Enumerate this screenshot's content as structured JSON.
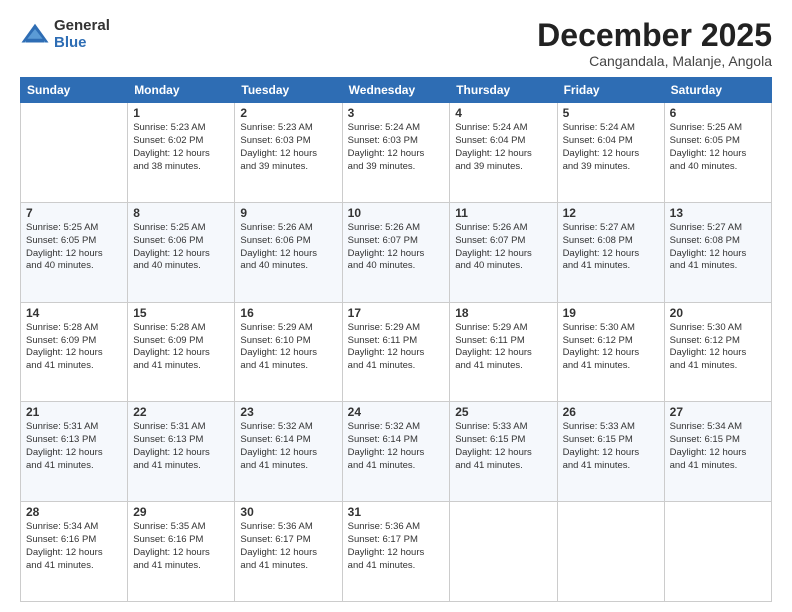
{
  "logo": {
    "general": "General",
    "blue": "Blue"
  },
  "title": {
    "month": "December 2025",
    "location": "Cangandala, Malanje, Angola"
  },
  "headers": [
    "Sunday",
    "Monday",
    "Tuesday",
    "Wednesday",
    "Thursday",
    "Friday",
    "Saturday"
  ],
  "weeks": [
    [
      {
        "day": "",
        "info": ""
      },
      {
        "day": "1",
        "info": "Sunrise: 5:23 AM\nSunset: 6:02 PM\nDaylight: 12 hours\nand 38 minutes."
      },
      {
        "day": "2",
        "info": "Sunrise: 5:23 AM\nSunset: 6:03 PM\nDaylight: 12 hours\nand 39 minutes."
      },
      {
        "day": "3",
        "info": "Sunrise: 5:24 AM\nSunset: 6:03 PM\nDaylight: 12 hours\nand 39 minutes."
      },
      {
        "day": "4",
        "info": "Sunrise: 5:24 AM\nSunset: 6:04 PM\nDaylight: 12 hours\nand 39 minutes."
      },
      {
        "day": "5",
        "info": "Sunrise: 5:24 AM\nSunset: 6:04 PM\nDaylight: 12 hours\nand 39 minutes."
      },
      {
        "day": "6",
        "info": "Sunrise: 5:25 AM\nSunset: 6:05 PM\nDaylight: 12 hours\nand 40 minutes."
      }
    ],
    [
      {
        "day": "7",
        "info": "Sunrise: 5:25 AM\nSunset: 6:05 PM\nDaylight: 12 hours\nand 40 minutes."
      },
      {
        "day": "8",
        "info": "Sunrise: 5:25 AM\nSunset: 6:06 PM\nDaylight: 12 hours\nand 40 minutes."
      },
      {
        "day": "9",
        "info": "Sunrise: 5:26 AM\nSunset: 6:06 PM\nDaylight: 12 hours\nand 40 minutes."
      },
      {
        "day": "10",
        "info": "Sunrise: 5:26 AM\nSunset: 6:07 PM\nDaylight: 12 hours\nand 40 minutes."
      },
      {
        "day": "11",
        "info": "Sunrise: 5:26 AM\nSunset: 6:07 PM\nDaylight: 12 hours\nand 40 minutes."
      },
      {
        "day": "12",
        "info": "Sunrise: 5:27 AM\nSunset: 6:08 PM\nDaylight: 12 hours\nand 41 minutes."
      },
      {
        "day": "13",
        "info": "Sunrise: 5:27 AM\nSunset: 6:08 PM\nDaylight: 12 hours\nand 41 minutes."
      }
    ],
    [
      {
        "day": "14",
        "info": "Sunrise: 5:28 AM\nSunset: 6:09 PM\nDaylight: 12 hours\nand 41 minutes."
      },
      {
        "day": "15",
        "info": "Sunrise: 5:28 AM\nSunset: 6:09 PM\nDaylight: 12 hours\nand 41 minutes."
      },
      {
        "day": "16",
        "info": "Sunrise: 5:29 AM\nSunset: 6:10 PM\nDaylight: 12 hours\nand 41 minutes."
      },
      {
        "day": "17",
        "info": "Sunrise: 5:29 AM\nSunset: 6:11 PM\nDaylight: 12 hours\nand 41 minutes."
      },
      {
        "day": "18",
        "info": "Sunrise: 5:29 AM\nSunset: 6:11 PM\nDaylight: 12 hours\nand 41 minutes."
      },
      {
        "day": "19",
        "info": "Sunrise: 5:30 AM\nSunset: 6:12 PM\nDaylight: 12 hours\nand 41 minutes."
      },
      {
        "day": "20",
        "info": "Sunrise: 5:30 AM\nSunset: 6:12 PM\nDaylight: 12 hours\nand 41 minutes."
      }
    ],
    [
      {
        "day": "21",
        "info": "Sunrise: 5:31 AM\nSunset: 6:13 PM\nDaylight: 12 hours\nand 41 minutes."
      },
      {
        "day": "22",
        "info": "Sunrise: 5:31 AM\nSunset: 6:13 PM\nDaylight: 12 hours\nand 41 minutes."
      },
      {
        "day": "23",
        "info": "Sunrise: 5:32 AM\nSunset: 6:14 PM\nDaylight: 12 hours\nand 41 minutes."
      },
      {
        "day": "24",
        "info": "Sunrise: 5:32 AM\nSunset: 6:14 PM\nDaylight: 12 hours\nand 41 minutes."
      },
      {
        "day": "25",
        "info": "Sunrise: 5:33 AM\nSunset: 6:15 PM\nDaylight: 12 hours\nand 41 minutes."
      },
      {
        "day": "26",
        "info": "Sunrise: 5:33 AM\nSunset: 6:15 PM\nDaylight: 12 hours\nand 41 minutes."
      },
      {
        "day": "27",
        "info": "Sunrise: 5:34 AM\nSunset: 6:15 PM\nDaylight: 12 hours\nand 41 minutes."
      }
    ],
    [
      {
        "day": "28",
        "info": "Sunrise: 5:34 AM\nSunset: 6:16 PM\nDaylight: 12 hours\nand 41 minutes."
      },
      {
        "day": "29",
        "info": "Sunrise: 5:35 AM\nSunset: 6:16 PM\nDaylight: 12 hours\nand 41 minutes."
      },
      {
        "day": "30",
        "info": "Sunrise: 5:36 AM\nSunset: 6:17 PM\nDaylight: 12 hours\nand 41 minutes."
      },
      {
        "day": "31",
        "info": "Sunrise: 5:36 AM\nSunset: 6:17 PM\nDaylight: 12 hours\nand 41 minutes."
      },
      {
        "day": "",
        "info": ""
      },
      {
        "day": "",
        "info": ""
      },
      {
        "day": "",
        "info": ""
      }
    ]
  ]
}
